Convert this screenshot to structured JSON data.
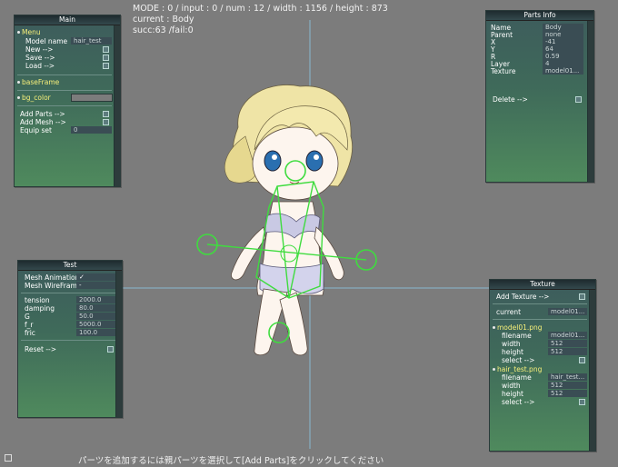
{
  "hud": {
    "line1": "MODE : 0 / input : 0 / num : 12 / width : 1156 / height : 873",
    "line2": "current : Body",
    "line3": "succ:63 /fail:0"
  },
  "main_panel": {
    "title": "Main",
    "menu_label": "Menu",
    "model_name_label": "Model name",
    "model_name_value": "hair_test",
    "new_label": "New  -->",
    "save_label": "Save  -->",
    "load_label": "Load  -->",
    "base_frame_label": "baseFrame",
    "bg_color_label": "bg_color",
    "add_parts_label": "Add Parts -->",
    "add_mesh_label": "Add Mesh -->",
    "equip_set_label": "Equip set",
    "equip_set_value": "0"
  },
  "parts_panel": {
    "title": "Parts Info",
    "fields": [
      {
        "label": "Name",
        "value": "Body"
      },
      {
        "label": "Parent",
        "value": "none"
      },
      {
        "label": "X",
        "value": "-41"
      },
      {
        "label": "Y",
        "value": "64"
      },
      {
        "label": "R",
        "value": "0.59"
      },
      {
        "label": "Layer",
        "value": "4"
      },
      {
        "label": "Texture",
        "value": "model01..."
      }
    ],
    "delete_label": "Delete  -->"
  },
  "test_panel": {
    "title": "Test",
    "mesh_animation_label": "Mesh Animation",
    "mesh_animation_value": "✓",
    "mesh_wireframe_label": "Mesh WireFrame",
    "mesh_wireframe_value": "-",
    "params": [
      {
        "label": "tension",
        "value": "2000.0"
      },
      {
        "label": "damping",
        "value": "80.0"
      },
      {
        "label": "G",
        "value": "50.0"
      },
      {
        "label": "f_r",
        "value": "5000.0"
      },
      {
        "label": "fric",
        "value": "100.0"
      }
    ],
    "reset_label": "Reset  -->"
  },
  "texture_panel": {
    "title": "Texture",
    "add_texture_label": "Add Texture -->",
    "current_label": "current",
    "current_value": "model01...",
    "textures": [
      {
        "name": "model01.png",
        "filename_label": "filename",
        "filename": "model01...",
        "width_label": "width",
        "width": "512",
        "height_label": "height",
        "height": "512",
        "select_label": "select  -->"
      },
      {
        "name": "hair_test.png",
        "filename_label": "filename",
        "filename": "hair_test...",
        "width_label": "width",
        "width": "512",
        "height_label": "height",
        "height": "512",
        "select_label": "select  -->"
      }
    ]
  },
  "status_message": "パーツを追加するには親パーツを選択して[Add Parts]をクリックしてください",
  "colors": {
    "background": "#7c7c7c",
    "panel_accent": "#4f8a5d",
    "folder_text": "#f7f07a",
    "guide_line": "#88b8d0",
    "handle": "#3fdc3f"
  }
}
